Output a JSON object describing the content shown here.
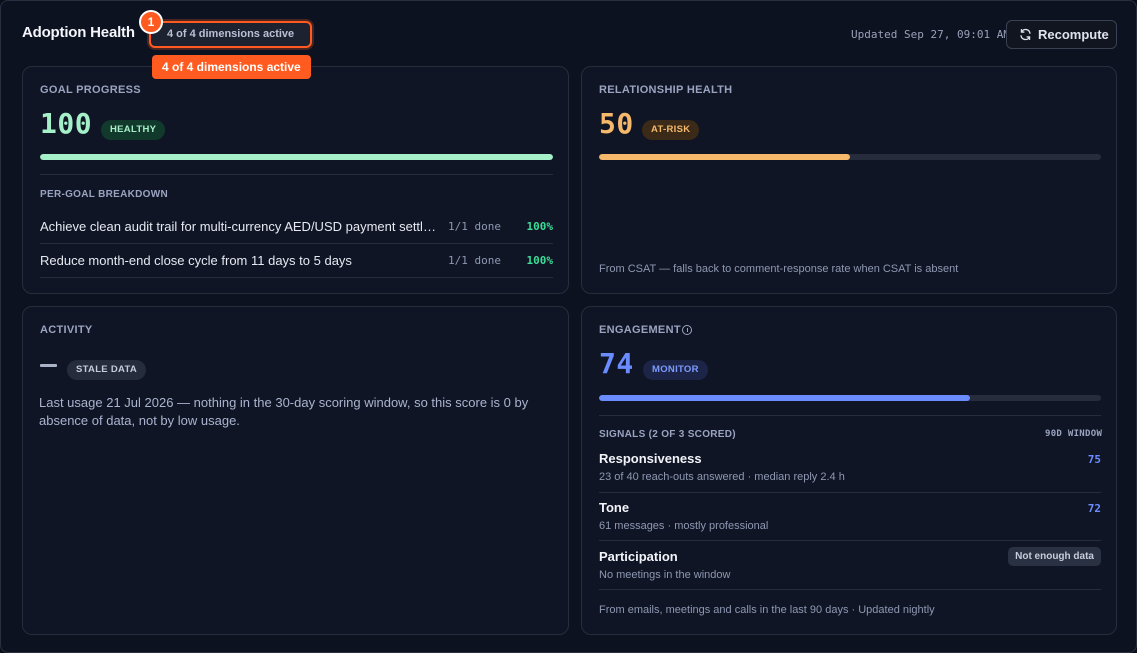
{
  "header": {
    "title": "Adoption Health",
    "dimensions_pill": "4 of 4 dimensions active",
    "marker_number": "1",
    "tooltip": "4 of 4 dimensions active",
    "updated": "Updated Sep 27, 09:01 AM",
    "recompute_label": "Recompute"
  },
  "goal_progress": {
    "eyebrow": "GOAL PROGRESS",
    "score": "100",
    "badge": "HEALTHY",
    "progress": 100,
    "breakdown_label": "PER-GOAL BREAKDOWN",
    "goals": [
      {
        "name": "Achieve clean audit trail for multi-currency AED/USD payment settle…",
        "done": "1/1 done",
        "pct": "100%"
      },
      {
        "name": "Reduce month-end close cycle from 11 days to 5 days",
        "done": "1/1 done",
        "pct": "100%"
      }
    ]
  },
  "relationship_health": {
    "eyebrow": "RELATIONSHIP HEALTH",
    "score": "50",
    "badge": "AT-RISK",
    "progress": 50,
    "note": "From CSAT — falls back to comment-response rate when CSAT is absent"
  },
  "activity": {
    "eyebrow": "ACTIVITY",
    "badge": "STALE DATA",
    "text": "Last usage 21 Jul 2026 — nothing in the 30-day scoring window, so this score is 0 by absence of data, not by low usage."
  },
  "engagement": {
    "eyebrow": "ENGAGEMENT",
    "score": "74",
    "badge": "MONITOR",
    "progress": 74,
    "signals_label": "SIGNALS (2 OF 3 SCORED)",
    "window_label": "90D WINDOW",
    "signals": [
      {
        "name": "Responsiveness",
        "desc": "23 of 40 reach-outs answered · median reply 2.4 h",
        "value": "75"
      },
      {
        "name": "Tone",
        "desc": "61 messages · mostly professional",
        "value": "72"
      },
      {
        "name": "Participation",
        "desc": "No meetings in the window",
        "status": "Not enough data"
      }
    ],
    "note": "From emails, meetings and calls in the last 90 days · Updated nightly"
  },
  "colors": {
    "healthy": "#a5f0c9",
    "at_risk": "#f6b86a",
    "monitor": "#6b8cff",
    "accent": "#ff5a1f"
  }
}
